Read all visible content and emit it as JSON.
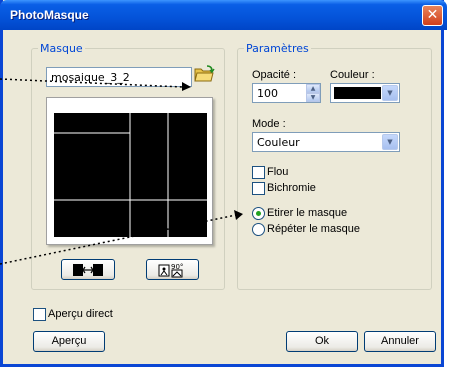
{
  "window": {
    "title": "PhotoMasque",
    "close_label": "✕"
  },
  "masque": {
    "legend": "Masque",
    "mask_name": "mosaique_3_2",
    "folder_icon": "folder-open-icon",
    "flip_icon": "flip-horizontal-icon",
    "rotate_icon": "rotate-90-icon",
    "rotate_label": "90°"
  },
  "parametres": {
    "legend": "Paramètres",
    "opacity_label": "Opacité :",
    "opacity_value": "100",
    "color_label": "Couleur :",
    "color_value": "#000000",
    "mode_label": "Mode :",
    "mode_value": "Couleur",
    "flou_label": "Flou",
    "flou_checked": false,
    "bichromie_label": "Bichromie",
    "bichromie_checked": false,
    "etirer_label": "Etirer le masque",
    "etirer_selected": true,
    "repeter_label": "Répéter le masque",
    "repeter_selected": false
  },
  "footer": {
    "apercu_direct_label": "Aperçu direct",
    "apercu_direct_checked": false,
    "apercu_button": "Aperçu",
    "ok_button": "Ok",
    "annuler_button": "Annuler"
  },
  "colors": {
    "title_bar": "#0453d9",
    "legend_text": "#0046d5",
    "dialog_bg": "#ece9d8",
    "selected_radio": "#21a121"
  }
}
